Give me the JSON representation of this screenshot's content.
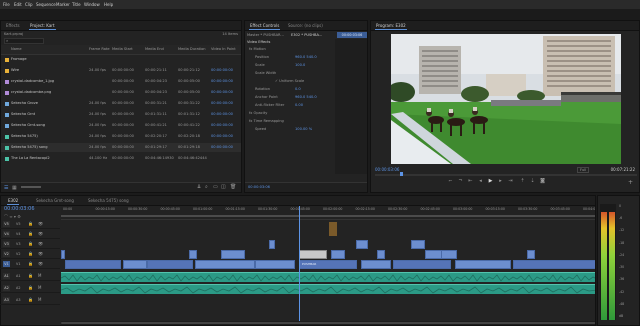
{
  "menu": [
    "File",
    "Edit",
    "Clip",
    "Sequence",
    "Marker",
    "Title",
    "Window",
    "Help"
  ],
  "project": {
    "tabs": [
      "Effects",
      "Project: Kart"
    ],
    "name": "Kart.prproj",
    "item_count": "14 Items",
    "columns": [
      "Name",
      "Frame Rate",
      "Media Start",
      "Media End",
      "Media Duration",
      "Video In Point"
    ],
    "rows": [
      {
        "name": "Fromage",
        "rate": "",
        "start": "",
        "end": "",
        "dur": "",
        "vin": "",
        "color": "#e8b23a"
      },
      {
        "name": "Wire",
        "rate": "24.00 fps",
        "start": "00:00:00:00",
        "end": "00:00:21:11",
        "dur": "00:00:21:12",
        "vin": "00:00:00:00",
        "color": "#e8b23a"
      },
      {
        "name": "crystal-dadcombe_1.jpg",
        "rate": "",
        "start": "00:00:00:00",
        "end": "00:00:04:23",
        "dur": "00:00:05:00",
        "vin": "00:00:00:00",
        "color": "#b18bd8"
      },
      {
        "name": "crystal-dadcombe.png",
        "rate": "",
        "start": "00:00:00:00",
        "end": "00:00:04:23",
        "dur": "00:00:05:00",
        "vin": "00:00:00:00",
        "color": "#b18bd8"
      },
      {
        "name": "Sekecha Grove",
        "rate": "24.00 fps",
        "start": "00:00:00:00",
        "end": "00:00:31:21",
        "dur": "00:00:31:22",
        "vin": "00:00:00:00",
        "color": "#6fa8dc"
      },
      {
        "name": "Sekecha Grnt",
        "rate": "24.00 fps",
        "start": "00:00:00:00",
        "end": "00:01:31:11",
        "dur": "00:01:31:12",
        "vin": "00:00:00:00",
        "color": "#6fa8dc"
      },
      {
        "name": "Sekecha Grnt-song",
        "rate": "24.00 fps",
        "start": "00:00:00:00",
        "end": "00:00:41:21",
        "dur": "00:00:41:22",
        "vin": "00:00:00:00",
        "color": "#6fa8dc"
      },
      {
        "name": "Sekecha 5475)",
        "rate": "24.00 fps",
        "start": "00:00:00:00",
        "end": "00:02:20:17",
        "dur": "00:02:20:18",
        "vin": "00:00:00:00",
        "color": "#4cc3a8"
      },
      {
        "name": "Sekecha 5475) song",
        "rate": "24.00 fps",
        "start": "00:00:00:00",
        "end": "00:01:29:17",
        "dur": "00:01:29:18",
        "vin": "00:00:00:00",
        "color": "#4cc3a8"
      },
      {
        "name": "The La La Rentacopi2",
        "rate": "44.100 Hz",
        "start": "00:00:00:00",
        "end": "00:04:46:14930",
        "dur": "00:04:46:42444",
        "vin": "",
        "color": "#4cc3a8"
      }
    ]
  },
  "effect_controls": {
    "tabs": [
      "Effect Controls",
      "Source: (no clips)"
    ],
    "master": "Master * PUSHBAR...",
    "sequence": "E302 * PUSHBA...",
    "timecode_badge": "00:00:03:06",
    "section": "Video Effects",
    "rows": [
      {
        "label": "fx Motion",
        "value": "",
        "indent": 0
      },
      {
        "label": "Position",
        "value": "960.0   540.0",
        "indent": 1
      },
      {
        "label": "Scale",
        "value": "100.0",
        "indent": 1
      },
      {
        "label": "Scale Width",
        "value": "",
        "indent": 1
      },
      {
        "label": "",
        "value": "✓ Uniform Scale",
        "indent": 2
      },
      {
        "label": "Rotation",
        "value": "0.0",
        "indent": 1
      },
      {
        "label": "Anchor Point",
        "value": "960.0   540.0",
        "indent": 1
      },
      {
        "label": "Anti-flicker Filter",
        "value": "0.00",
        "indent": 1
      },
      {
        "label": "fx Opacity",
        "value": "",
        "indent": 0
      },
      {
        "label": "fx Time Remapping",
        "value": "",
        "indent": 0
      },
      {
        "label": "Speed",
        "value": "100.00 %",
        "indent": 1
      }
    ],
    "footer_time": "00:00:03:06"
  },
  "program": {
    "tab": "Program: E302",
    "timecode": "00:00:03:06",
    "fit": "Full",
    "duration": "00:07:21:22"
  },
  "timeline": {
    "tabs": [
      "E302",
      "Sekecha Grnt-song",
      "Sekecha 5475) song"
    ],
    "timecode": "00:00:03:06",
    "ruler": [
      "00:00",
      "00:00:15:00",
      "00:00:30:00",
      "00:00:45:00",
      "00:01:00:00",
      "00:01:15:00",
      "00:01:30:00",
      "00:01:45:00",
      "00:02:00:00",
      "00:02:15:00",
      "00:02:30:00",
      "00:02:45:00",
      "00:03:00:00",
      "00:03:15:00",
      "00:03:30:00",
      "00:03:45:00",
      "00:04:00:00"
    ],
    "video_tracks": [
      "V5",
      "V4",
      "V3",
      "V2",
      "V1"
    ],
    "audio_tracks": [
      "A1",
      "A2",
      "A3"
    ],
    "clip_labels": {
      "pushbar": "PUSHBAR",
      "green": "Greek Sale",
      "sekecha": "5-6C3"
    }
  },
  "meter": {
    "labels": [
      "0",
      "-6",
      "-12",
      "-18",
      "-24",
      "-30",
      "-36",
      "-42",
      "-48",
      "dB"
    ]
  },
  "colors": {
    "accent": "#5d94e6",
    "video_clip": "#6c8ecf",
    "audio_clip": "#2b9a86"
  }
}
